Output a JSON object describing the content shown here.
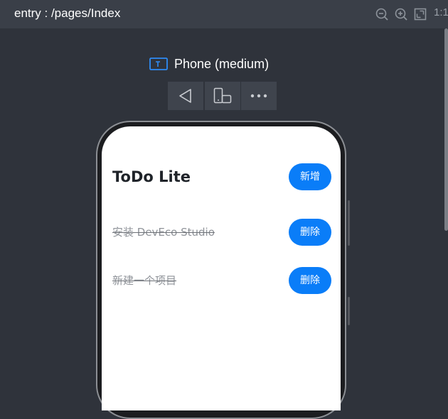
{
  "toolbar": {
    "title": "entry : /pages/Index",
    "tools": [
      {
        "icon": "zoom-out-icon"
      },
      {
        "icon": "zoom-in-icon"
      },
      {
        "icon": "fit-screen-icon"
      }
    ],
    "ratio_label": "1:1"
  },
  "device": {
    "icon": "device-type-icon",
    "name": "Phone (medium)"
  },
  "controls": [
    {
      "icon": "back-icon"
    },
    {
      "icon": "rotate-device-icon"
    },
    {
      "icon": "more-icon"
    }
  ],
  "app": {
    "title": "ToDo Lite",
    "add_label": "新增",
    "items": [
      {
        "text": "安装 DevEco Studio",
        "action": "删除",
        "completed": true
      },
      {
        "text": "新建一个项目",
        "action": "删除",
        "completed": true
      }
    ]
  },
  "colors": {
    "accent": "#0a7df8",
    "background": "#2f333b",
    "toolbar": "#3a3f48"
  }
}
